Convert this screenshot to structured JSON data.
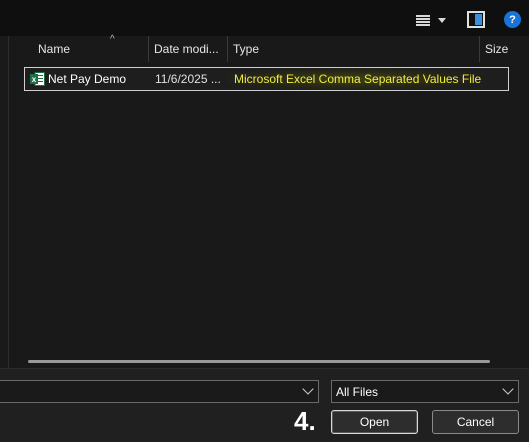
{
  "toolbar": {
    "view_menu_icon": "list-view-icon",
    "preview_pane_icon": "preview-pane-icon",
    "help_icon": "help-icon",
    "help_glyph": "?"
  },
  "file_list": {
    "columns": [
      "Name",
      "Date modi...",
      "Type",
      "Size"
    ],
    "sort_indicator": "^",
    "files": [
      {
        "icon": "excel-csv-icon",
        "name": "Net Pay Demo",
        "date": "11/6/2025 ...",
        "type": "Microsoft Excel Comma Separated Values File",
        "size": ""
      }
    ],
    "highlight_color": "#e8e826"
  },
  "bottom": {
    "filename_value": "",
    "filetype_selected": "All Files",
    "step_annotation": "4.",
    "open_label": "Open",
    "cancel_label": "Cancel"
  }
}
